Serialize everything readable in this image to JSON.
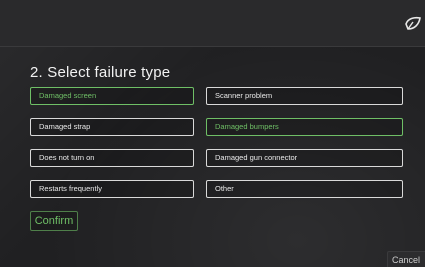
{
  "header": {
    "logo_icon": "brand-leaf-icon"
  },
  "step": {
    "title": "2. Select failure type"
  },
  "options": [
    {
      "label": "Damaged screen",
      "selected": true
    },
    {
      "label": "Scanner problem",
      "selected": false
    },
    {
      "label": "Damaged strap",
      "selected": false
    },
    {
      "label": "Damaged bumpers",
      "selected": true
    },
    {
      "label": "Does not turn on",
      "selected": false
    },
    {
      "label": "Damaged gun connector",
      "selected": false
    },
    {
      "label": "Restarts frequently",
      "selected": false
    },
    {
      "label": "Other",
      "selected": false
    }
  ],
  "actions": {
    "confirm_label": "Confirm",
    "cancel_label": "Cancel"
  },
  "colors": {
    "accent": "#6fbf66",
    "background": "#202022"
  }
}
